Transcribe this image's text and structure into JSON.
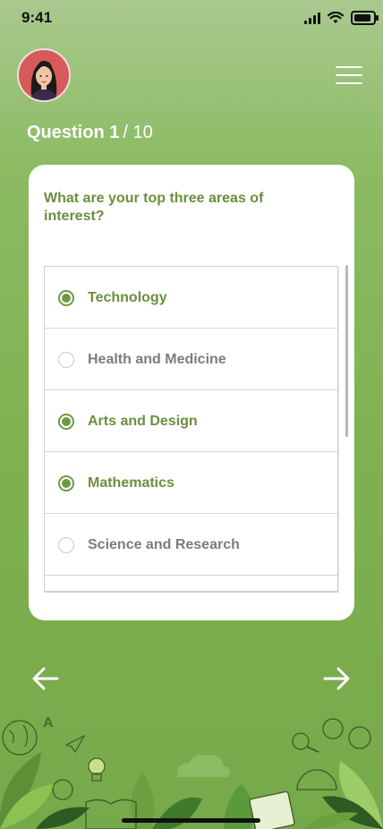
{
  "status_bar": {
    "time": "9:41"
  },
  "header": {
    "avatar_alt": "user avatar"
  },
  "question": {
    "label": "Question 1",
    "total": "/ 10",
    "text": "What are your top three areas of interest?"
  },
  "options": [
    {
      "label": "Technology",
      "selected": true
    },
    {
      "label": "Health and Medicine",
      "selected": false
    },
    {
      "label": "Arts and Design",
      "selected": true
    },
    {
      "label": "Mathematics",
      "selected": true
    },
    {
      "label": "Science and Research",
      "selected": false
    }
  ],
  "colors": {
    "accent": "#6b8f3e",
    "background": "#7fb150"
  }
}
